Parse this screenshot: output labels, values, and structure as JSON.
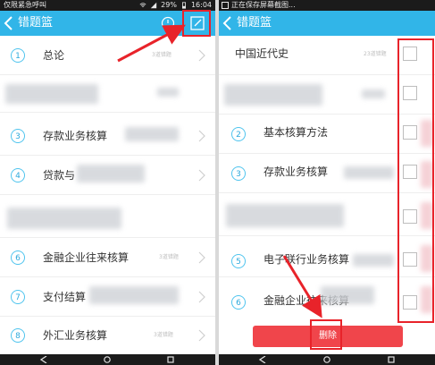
{
  "left_panel": {
    "status_bar": {
      "carrier": "仅限紧急呼叫",
      "battery": "29%",
      "time": "16:04"
    },
    "title": "错题篮",
    "items": [
      {
        "number": "1",
        "label": "总论",
        "count": "3道错题"
      },
      {
        "number": "3",
        "label": "存款业务核算",
        "count": ""
      },
      {
        "number": "4",
        "label": "贷款与",
        "count": ""
      },
      {
        "number": "6",
        "label": "金融企业往来核算",
        "count": "3道错题"
      },
      {
        "number": "7",
        "label": "支付结算",
        "count": ""
      },
      {
        "number": "8",
        "label": "外汇业务核算",
        "count": "3道错题"
      }
    ]
  },
  "right_panel": {
    "status_bar": {
      "notice": "正在保存屏幕截图..."
    },
    "title": "错题篮",
    "items": [
      {
        "number": "",
        "label": "中国近代史",
        "count": "23道错题"
      },
      {
        "number": "2",
        "label": "基本核算方法",
        "count": ""
      },
      {
        "number": "3",
        "label": "存款业务核算",
        "count": ""
      },
      {
        "number": "5",
        "label": "电子联行业务核算",
        "count": ""
      },
      {
        "number": "6",
        "label": "金融企业往来核算",
        "count": ""
      }
    ],
    "delete_label": "删除"
  },
  "colors": {
    "header": "#31b5e8",
    "delete": "#f0454b",
    "annotation": "#e8232a",
    "number_ring": "#4fc4ee"
  }
}
